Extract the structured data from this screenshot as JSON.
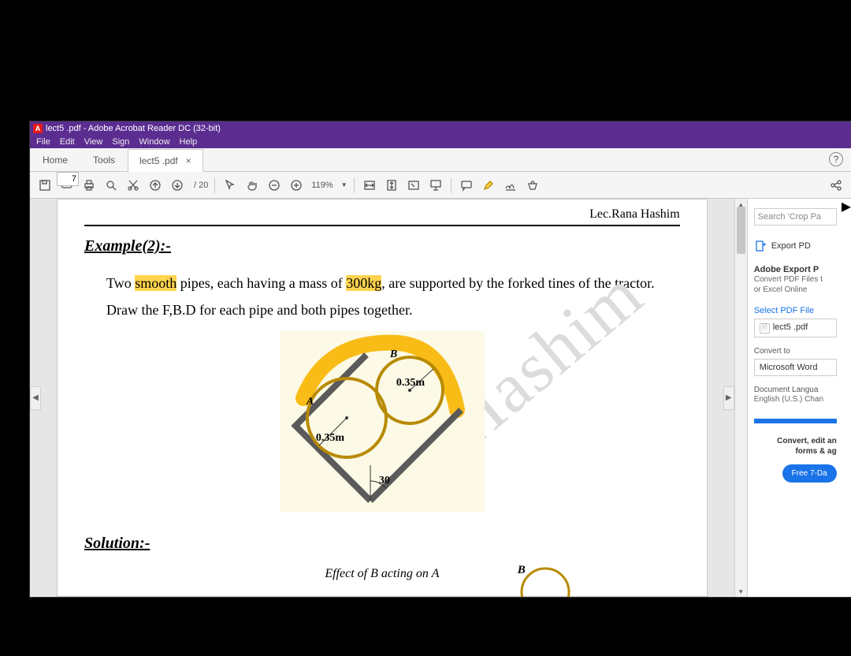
{
  "titlebar": {
    "text": "lect5 .pdf - Adobe Acrobat Reader DC (32-bit)"
  },
  "menubar": [
    "File",
    "Edit",
    "View",
    "Sign",
    "Window",
    "Help"
  ],
  "tabs": {
    "home": "Home",
    "tools": "Tools",
    "active": "lect5 .pdf"
  },
  "toolbar": {
    "page_current": "7",
    "page_total": "/ 20",
    "zoom": "119%"
  },
  "doc": {
    "lecturer": "Lec.Rana Hashim",
    "heading": "Example(2):-",
    "p1a": "Two ",
    "p1b": "smooth",
    "p1c": " pipes, each having a mass of ",
    "p1d": "300kg",
    "p1e": ", are supported by the forked tines of the tractor. Draw the F,B.D for each pipe and both pipes together.",
    "fig": {
      "A": "A",
      "B": "B",
      "r1": "0.35m",
      "r2": "0.35m",
      "ang": "30"
    },
    "solution": "Solution:-",
    "effect": "Effect of B acting on A",
    "watermark": "Hashim",
    "fig2B": "B"
  },
  "side": {
    "search_ph": "Search 'Crop Pa",
    "export": "Export PD",
    "adobe_h": "Adobe Export P",
    "adobe_s1": "Convert PDF Files t",
    "adobe_s2": "or Excel Online",
    "select": "Select PDF File",
    "file": "lect5 .pdf",
    "convert_to": "Convert to",
    "target": "Microsoft Word",
    "lang1": "Document Langua",
    "lang2": "English (U.S.)  Chan",
    "cta1": "Convert, edit an",
    "cta2": "forms & ag",
    "pill": "Free 7-Da"
  }
}
